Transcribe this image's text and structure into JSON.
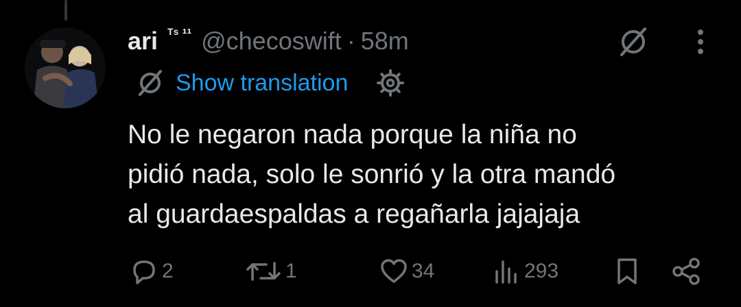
{
  "tweet": {
    "author_name": "ari",
    "author_badges": "ᵀˢ ¹¹",
    "handle": "@checoswift",
    "separator": "·",
    "time": "58m",
    "translate_label": "Show translation",
    "text": "No le negaron nada porque la niña no\npidió nada, solo le sonrió y la otra mandó\nal guardaespaldas a regañarla jajajaja"
  },
  "actions": {
    "replies": "2",
    "retweets": "1",
    "likes": "34",
    "views": "293"
  },
  "icons": {
    "grok": "grok-icon",
    "more": "more-options-icon",
    "translate": "grok-translate-icon",
    "settings": "gear-icon",
    "reply": "reply-icon",
    "retweet": "retweet-icon",
    "like": "heart-icon",
    "views": "views-icon",
    "bookmark": "bookmark-icon",
    "share": "share-icon"
  },
  "colors": {
    "background": "#000000",
    "text": "#e7e9ea",
    "secondary": "#71767b",
    "link": "#1d9bf0"
  }
}
